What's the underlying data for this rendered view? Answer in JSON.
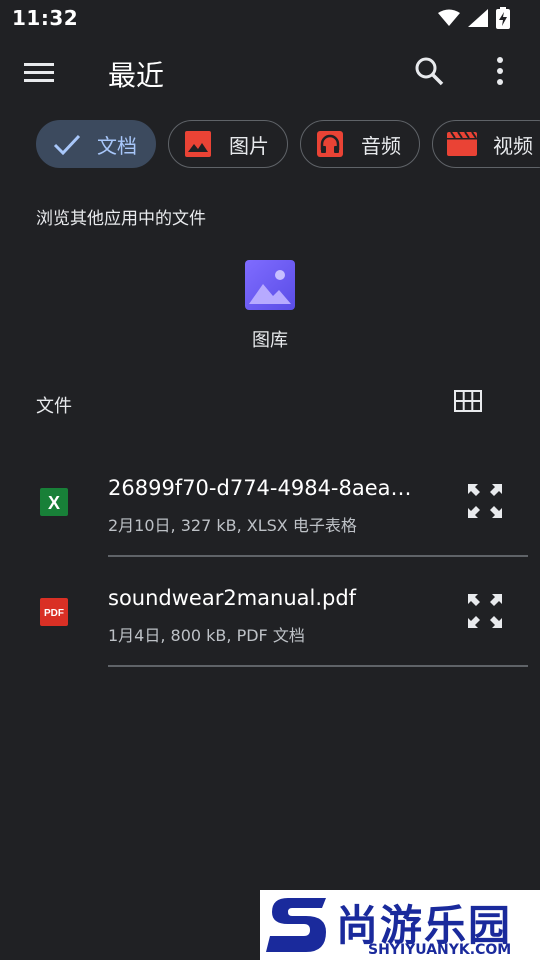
{
  "status_bar": {
    "time": "11:32",
    "icons": [
      "wifi-icon",
      "signal-icon",
      "battery-charging-icon"
    ]
  },
  "app_bar": {
    "title": "最近",
    "icons": [
      "menu-icon",
      "search-icon",
      "more-vert-icon"
    ]
  },
  "chips": [
    {
      "label": "文档",
      "icon": "check-icon",
      "selected": true,
      "color": "#a8c7fa"
    },
    {
      "label": "图片",
      "icon": "image-icon",
      "selected": false,
      "color": "#ea4335"
    },
    {
      "label": "音频",
      "icon": "headphones-icon",
      "selected": false,
      "color": "#ea4335"
    },
    {
      "label": "视频",
      "icon": "video-icon",
      "selected": false,
      "color": "#ea4335"
    }
  ],
  "browse_section": {
    "title": "浏览其他应用中的文件",
    "apps": [
      {
        "label": "图库",
        "icon": "gallery-icon",
        "color": "#7b61ff"
      }
    ]
  },
  "files_section": {
    "title": "文件",
    "view_toggle_icon": "grid-view-icon"
  },
  "files": [
    {
      "name": "26899f70-d774-4984-8aea-...",
      "meta": "2月10日, 327 kB, XLSX 电子表格",
      "icon": "xlsx-icon",
      "icon_text": "X",
      "color": "#188038"
    },
    {
      "name": "soundwear2manual.pdf",
      "meta": "1月4日, 800 kB, PDF 文档",
      "icon": "pdf-icon",
      "icon_text": "PDF",
      "color": "#d93025"
    }
  ],
  "watermark": {
    "title": "尚游乐园",
    "url": "SHYIYUANYK.COM",
    "color": "#1a2a9c"
  }
}
